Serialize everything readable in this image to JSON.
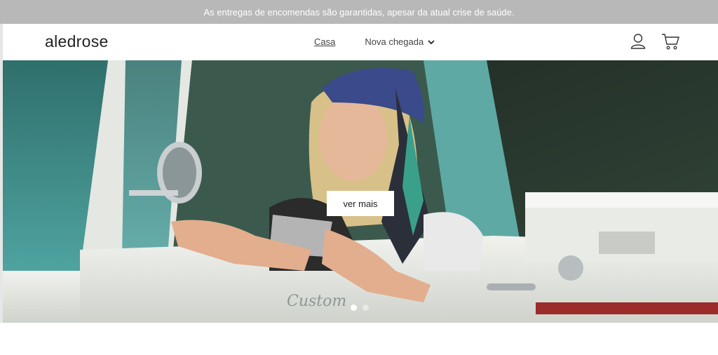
{
  "announcement": {
    "text": "As entregas de encomendas são garantidas, apesar da atual crise de saúde."
  },
  "header": {
    "logo": "aledrose",
    "nav": {
      "home": "Casa",
      "new_arrival": "Nova chegada"
    },
    "icons": {
      "account": "user-icon",
      "cart": "cart-icon",
      "dropdown": "chevron-down-icon"
    }
  },
  "hero": {
    "cta_label": "ver mais",
    "slides_total": 2,
    "active_slide": 1,
    "colors": {
      "truck": "#e9ebe6",
      "window": "#3f8e8a",
      "background": "#26352c"
    }
  }
}
